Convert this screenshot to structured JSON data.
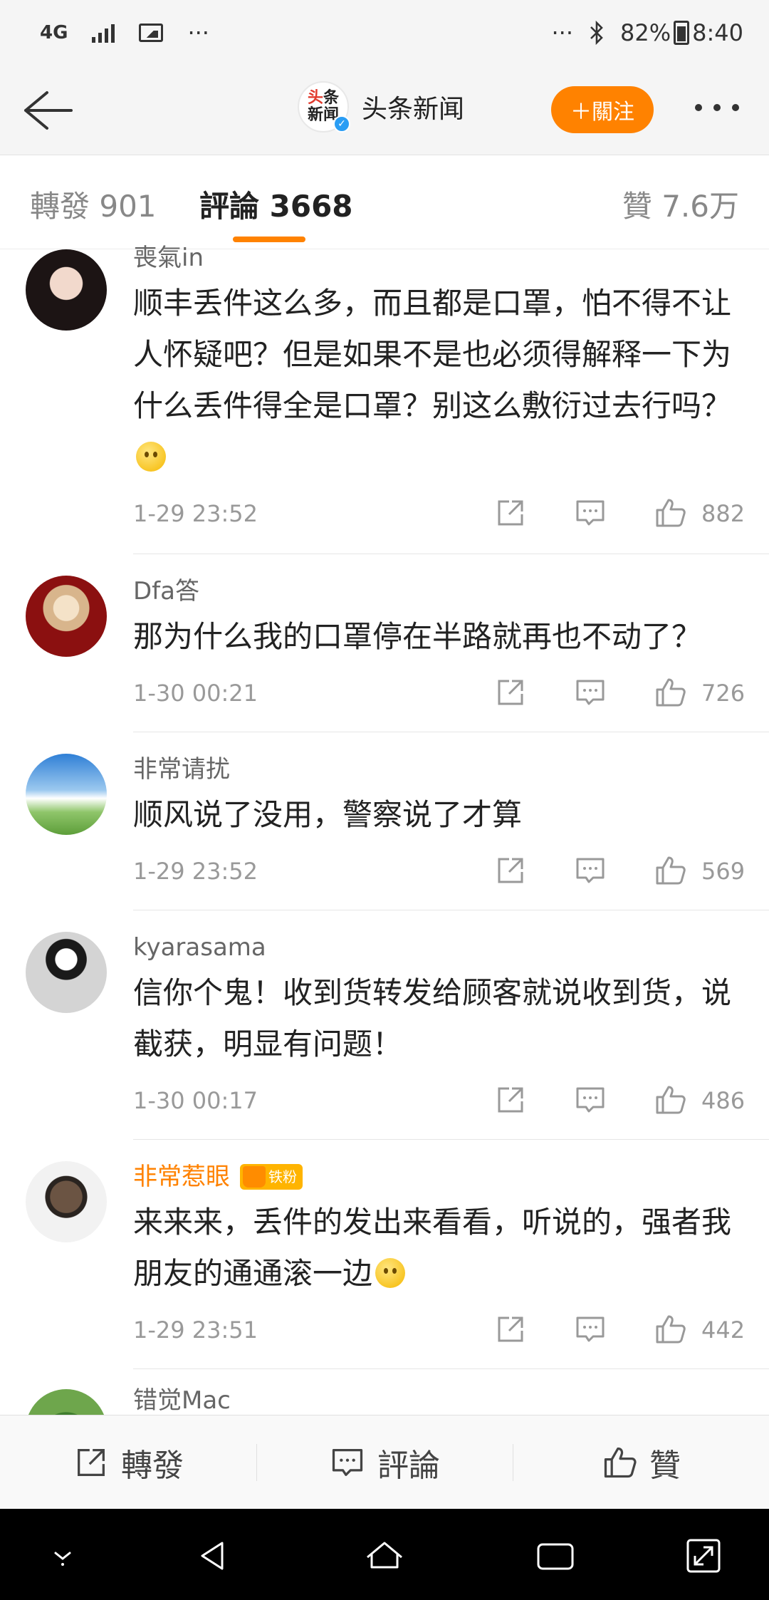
{
  "status_bar": {
    "network": "4G",
    "notification_dots": "···",
    "right_dots": "···",
    "battery": "82%",
    "time": "8:40"
  },
  "header": {
    "account_name": "头条新闻",
    "logo_line1_a": "头",
    "logo_line1_b": "条",
    "logo_line2": "新闻",
    "follow_label": "＋關注"
  },
  "tabs": {
    "repost": "轉發 901",
    "comments": "評論 3668",
    "likes": "贊 7.6万"
  },
  "comments": [
    {
      "username": "喪氣in",
      "text": "顺丰丢件这么多，而且都是口罩，怕不得不让人怀疑吧？但是如果不是也必须得解释一下为什么丢件得全是口罩？别这么敷衍过去行吗？",
      "emoji": "thinking-emoji",
      "time": "1-29 23:52",
      "likes": "882"
    },
    {
      "username": "Dfa答",
      "text": "那为什么我的口罩停在半路就再也不动了？",
      "time": "1-30 00:21",
      "likes": "726"
    },
    {
      "username": "非常请扰",
      "text": "顺风说了没用，警察说了才算",
      "time": "1-29 23:52",
      "likes": "569"
    },
    {
      "username": "kyarasama",
      "text": "信你个鬼！收到货转发给顾客就说收到货，说截获，明显有问题！",
      "time": "1-30 00:17",
      "likes": "486"
    },
    {
      "username": "非常惹眼",
      "badge": "铁粉",
      "text": "来来来，丢件的发出来看看，听说的，强者我朋友的通通滚一边",
      "emoji": "smile-emoji",
      "time": "1-29 23:51",
      "likes": "442"
    },
    {
      "username": "错觉Mac"
    }
  ],
  "bottom_bar": {
    "repost": "轉發",
    "comment": "評論",
    "like": "贊"
  },
  "colors": {
    "accent": "#ff8200",
    "verified": "#2a9df4",
    "nav_bg": "#f5f5f5",
    "android_nav": "#000000"
  }
}
